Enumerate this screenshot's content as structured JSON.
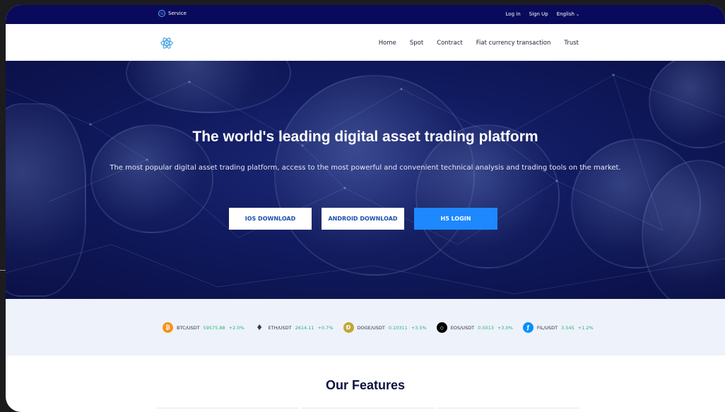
{
  "topbar": {
    "service_label": "Service",
    "login": "Log in",
    "signup": "Sign Up",
    "language": "English"
  },
  "nav": {
    "items": [
      "Home",
      "Spot",
      "Contract",
      "Fiat currency transaction",
      "Trust"
    ]
  },
  "hero": {
    "title": "The world's leading digital asset trading platform",
    "subtitle": "The most popular digital asset trading platform, access to the most powerful and convenient technical analysis and trading tools on the market.",
    "buttons": {
      "ios": "IOS DOWNLOAD",
      "android": "ANDROID DOWNLOAD",
      "h5": "H5 LOGIN"
    }
  },
  "ticker": [
    {
      "pair": "BTC/USDT",
      "price": "59575.88",
      "change": "+2.0%",
      "icon": "bitcoin-icon",
      "color": "#f7931a"
    },
    {
      "pair": "ETH/USDT",
      "price": "2614.11",
      "change": "+0.7%",
      "icon": "ethereum-icon",
      "color": "#3c3c3d"
    },
    {
      "pair": "DOGE/USDT",
      "price": "0.10311",
      "change": "+3.5%",
      "icon": "dogecoin-icon",
      "color": "#c2a633"
    },
    {
      "pair": "EOS/USDT",
      "price": "0.5013",
      "change": "+3.0%",
      "icon": "eos-icon",
      "color": "#000000"
    },
    {
      "pair": "FIL/USDT",
      "price": "3.545",
      "change": "+1.2%",
      "icon": "filecoin-icon",
      "color": "#0090ff"
    }
  ],
  "features": {
    "title": "Our Features"
  },
  "colors": {
    "topbar": "#0a0a5c",
    "accent": "#1e88ff",
    "positive": "#27b07a",
    "ticker_bg": "#eef2fa"
  }
}
